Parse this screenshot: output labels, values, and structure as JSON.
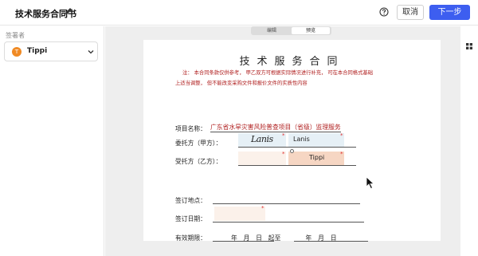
{
  "header": {
    "title": "技术服务合同书",
    "cancel_label": "取消",
    "next_label": "下一步"
  },
  "sidebar": {
    "label": "签署者",
    "signer": {
      "initial": "T",
      "name": "Tippi"
    }
  },
  "view_toggle": {
    "edit_label": "编辑",
    "preview_label": "预览",
    "active": "preview"
  },
  "contract": {
    "title": "技术服务合同",
    "note_line1": "注： 本合同条款仅供参考， 甲乙双方可根据实际情况进行补充， 可在本合同格式基础",
    "note_line2": "上适当调整， 但不能改变采购文件和报价文件的实质性内容",
    "project_label": "项目名称：",
    "project_value": "广东省水旱灾害风险普查项目（省级）监理服务",
    "party_a_label": "委托方（甲方）：",
    "party_b_label": "受托方（乙方）：",
    "sign_place_label": "签订地点：",
    "sign_date_label": "签订日期：",
    "validity_label": "有效期限：",
    "validity_text": "年　月　日　起至　　　　年　月　日",
    "party_a_handwritten": "Lanis",
    "party_a_name_field": "Lanis",
    "party_b_name_field": "Tippi",
    "required_mark": "*"
  },
  "colors": {
    "primary": "#3d5ef0",
    "avatar": "#f08a24",
    "party_a_field": "#e6f0f6",
    "party_b_field": "#f6d6c3",
    "note_red": "#b02020"
  },
  "icons": [
    "edit-icon",
    "help-icon",
    "chevron-down-icon",
    "grid-icon",
    "mouse-cursor-icon"
  ]
}
